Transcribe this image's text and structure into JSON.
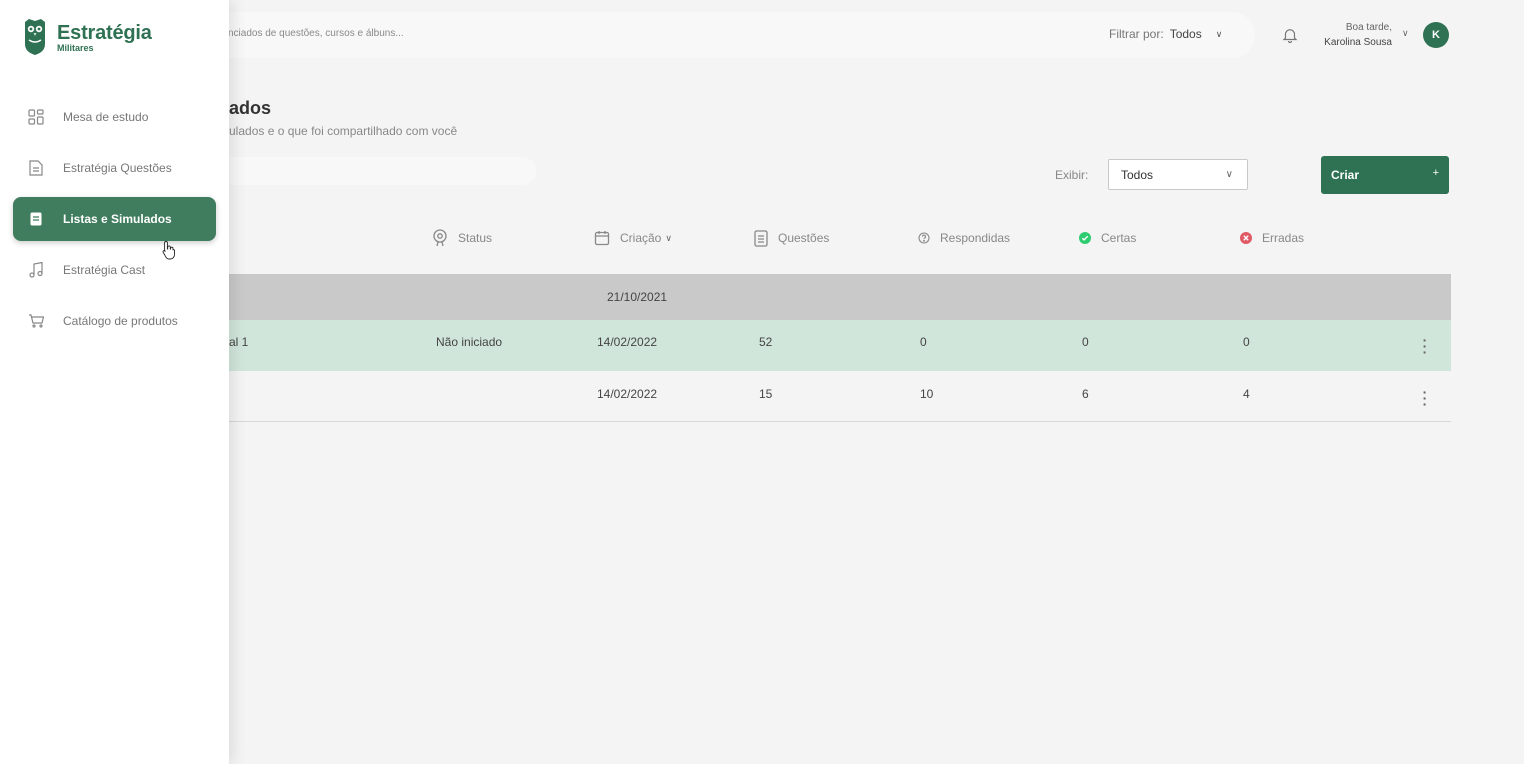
{
  "brand": {
    "name": "Estratégia",
    "sub": "Militares"
  },
  "header": {
    "search_placeholder": "nciados de questões, cursos e álbuns...",
    "filter_label": "Filtrar por:",
    "filter_value": "Todos",
    "greeting": "Boa tarde,",
    "user_name": "Karolina Sousa",
    "avatar_initial": "K"
  },
  "page": {
    "title": "ados",
    "subtitle": "ulados e o que foi compartilhado com você"
  },
  "toolbar": {
    "exibir_label": "Exibir:",
    "exibir_value": "Todos",
    "create_label": "Criar",
    "create_icon": "+"
  },
  "sidebar": {
    "items": [
      {
        "label": "Mesa de estudo",
        "icon": "dashboard-icon"
      },
      {
        "label": "Estratégia Questões",
        "icon": "document-icon"
      },
      {
        "label": "Listas e Simulados",
        "icon": "list-icon",
        "active": true
      },
      {
        "label": "Estratégia Cast",
        "icon": "music-icon"
      },
      {
        "label": "Catálogo de produtos",
        "icon": "cart-icon"
      }
    ]
  },
  "table": {
    "headers": {
      "status": "Status",
      "criacao": "Criação",
      "questoes": "Questões",
      "respondidas": "Respondidas",
      "certas": "Certas",
      "erradas": "Erradas"
    },
    "group_date": "21/10/2021",
    "rows": [
      {
        "name": "al 1",
        "status": "Não iniciado",
        "criacao": "14/02/2022",
        "questoes": "52",
        "respondidas": "0",
        "certas": "0",
        "erradas": "0"
      },
      {
        "name": "",
        "status": "",
        "criacao": "14/02/2022",
        "questoes": "15",
        "respondidas": "10",
        "certas": "6",
        "erradas": "4"
      }
    ]
  },
  "colors": {
    "brand": "#2f7153",
    "active_nav": "#3f7d5e",
    "row_highlight": "#d1e6db",
    "group_row": "#c9c9c9",
    "correct": "#2ecc71",
    "wrong": "#e05a66"
  }
}
